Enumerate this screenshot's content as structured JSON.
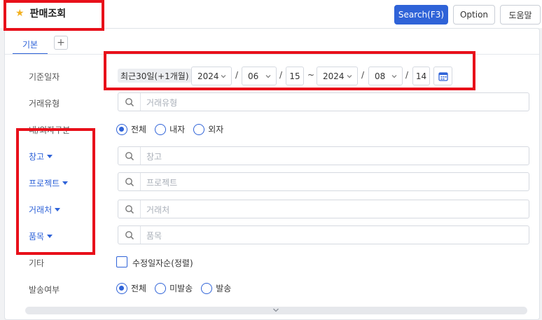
{
  "header": {
    "title": "판매조회",
    "star_icon": "star-icon",
    "buttons": {
      "search": "Search(F3)",
      "option": "Option",
      "help": "도움말"
    }
  },
  "tabs": {
    "active": "기본",
    "add": "+"
  },
  "form": {
    "base_date": {
      "label": "기준일자",
      "preset": "최근30일(+1개월)",
      "from_year": "2024",
      "from_month": "06",
      "from_day": "15",
      "tilde": "~",
      "to_year": "2024",
      "to_month": "08",
      "to_day": "14",
      "slash": "/"
    },
    "trade_type": {
      "label": "거래유형",
      "placeholder": "거래유형"
    },
    "domestic_foreign": {
      "label": "내/외자구분",
      "options": [
        "전체",
        "내자",
        "외자"
      ],
      "selected": "전체"
    },
    "warehouse": {
      "label": "창고",
      "placeholder": "창고"
    },
    "project": {
      "label": "프로젝트",
      "placeholder": "프로젝트"
    },
    "customer": {
      "label": "거래처",
      "placeholder": "거래처"
    },
    "item": {
      "label": "품목",
      "placeholder": "품목"
    },
    "etc": {
      "label": "기타",
      "checkbox_label": "수정일자순(정렬)",
      "checked": false
    },
    "send_status": {
      "label": "발송여부",
      "options": [
        "전체",
        "미발송",
        "발송"
      ],
      "selected": "전체"
    }
  },
  "colors": {
    "accent": "#2f63d8",
    "highlight": "#e8101a",
    "star": "#f2b01e"
  }
}
